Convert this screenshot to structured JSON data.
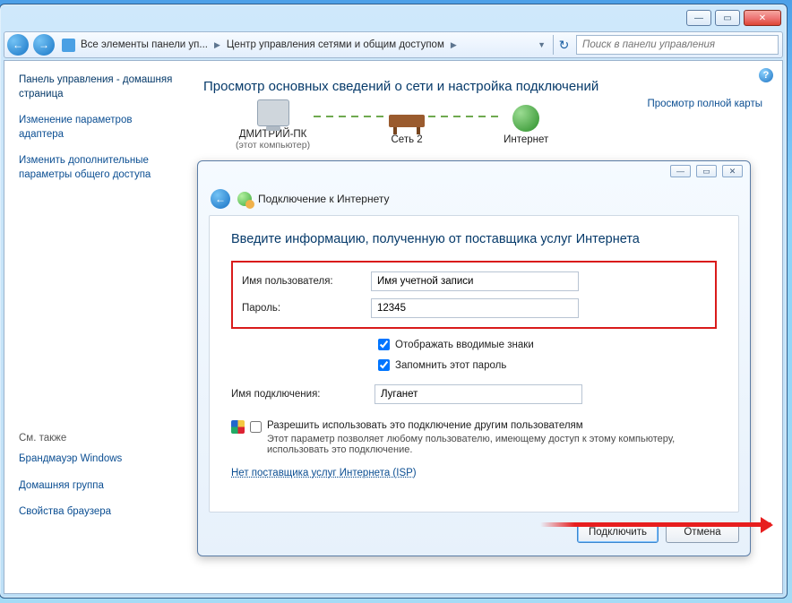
{
  "window": {
    "breadcrumb": [
      "Все элементы панели уп...",
      "Центр управления сетями и общим доступом"
    ],
    "search_placeholder": "Поиск в панели управления"
  },
  "sidebar": {
    "home": "Панель управления - домашняя страница",
    "links": [
      "Изменение параметров адаптера",
      "Изменить дополнительные параметры общего доступа"
    ],
    "seealso_title": "См. также",
    "seealso": [
      "Брандмауэр Windows",
      "Домашняя группа",
      "Свойства браузера"
    ]
  },
  "main": {
    "title": "Просмотр основных сведений о сети и настройка подключений",
    "node_pc": "ДМИТРИЙ-ПК",
    "node_pc_sub": "(этот компьютер)",
    "node_net": "Сеть 2",
    "node_inet": "Интернет",
    "map_link": "Просмотр полной карты"
  },
  "dialog": {
    "header": "Подключение к Интернету",
    "title": "Введите информацию, полученную от поставщика услуг Интернета",
    "user_label": "Имя пользователя:",
    "user_value": "Имя учетной записи",
    "pass_label": "Пароль:",
    "pass_value": "12345",
    "show_chars": "Отображать вводимые знаки",
    "remember": "Запомнить этот пароль",
    "conn_label": "Имя подключения:",
    "conn_value": "Луганет",
    "share_label": "Разрешить использовать это подключение другим пользователям",
    "share_sub": "Этот параметр позволяет любому пользователю, имеющему доступ к этому компьютеру, использовать это подключение.",
    "no_isp": "Нет поставщика услуг Интернета (ISP)",
    "connect": "Подключить",
    "cancel": "Отмена"
  }
}
